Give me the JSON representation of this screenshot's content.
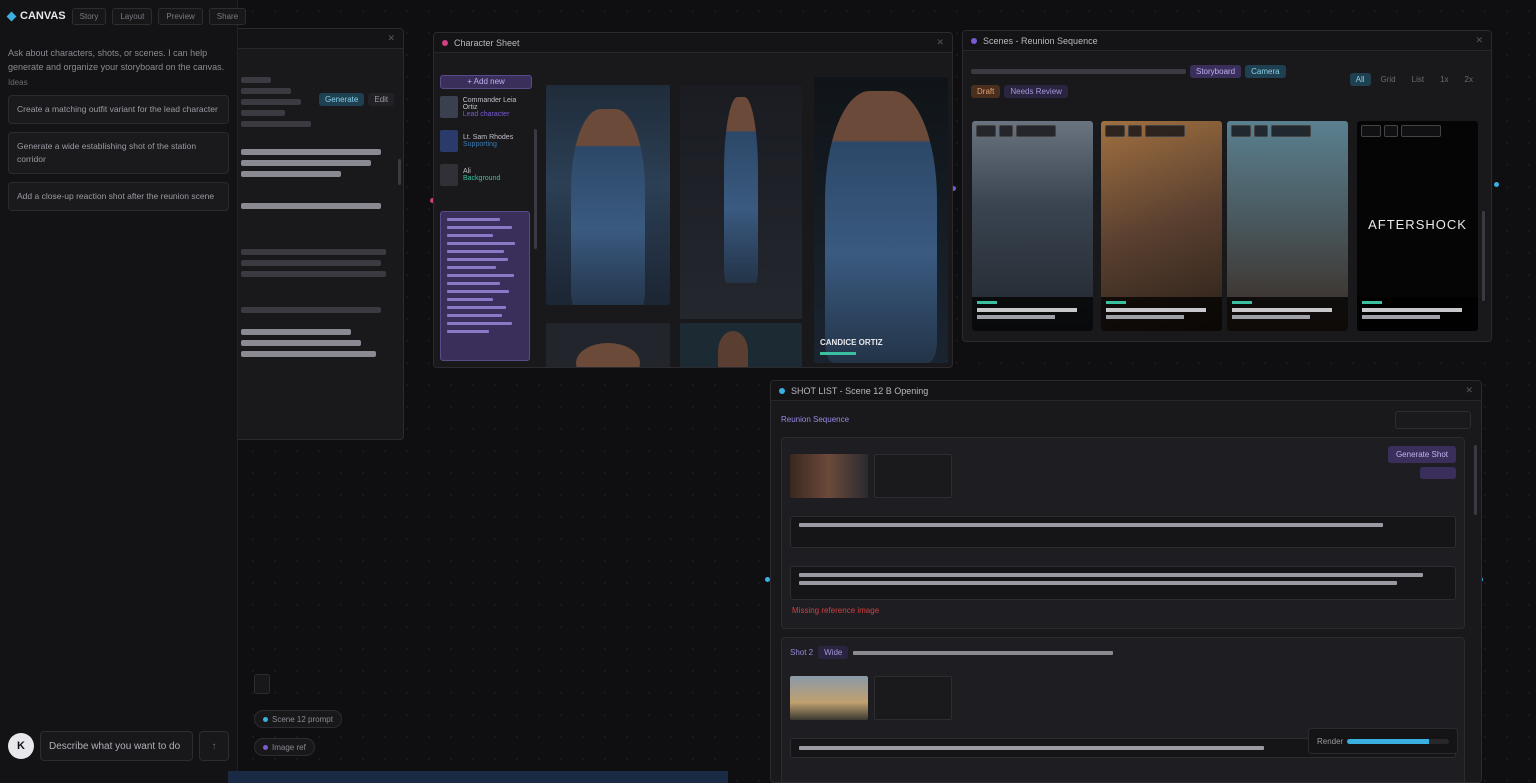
{
  "app": {
    "name": "CANVAS",
    "top_tabs": [
      "Story",
      "Layout",
      "Preview",
      "Share"
    ]
  },
  "chat": {
    "intro": "Ask about characters, shots, or scenes. I can help generate and organize your storyboard on the canvas.",
    "section_label": "Ideas",
    "suggestions": [
      "Create a matching outfit variant for the lead character",
      "Generate a wide establishing shot of the station corridor",
      "Add a close-up reaction shot after the reunion scene"
    ],
    "composer_placeholder": "Describe what you want to do",
    "user_initial": "K"
  },
  "text_panel": {
    "action_label": "Generate",
    "action_secondary": "Edit"
  },
  "character_panel": {
    "title": "Character Sheet",
    "add_label": "+ Add new",
    "characters": [
      {
        "name": "Commander Leia Ortiz",
        "sub": "Lead character"
      },
      {
        "name": "Lt. Sam Rhodes",
        "sub": "Supporting"
      },
      {
        "name": "Ali",
        "sub": "Background"
      }
    ],
    "caption": "CANDICE ORTIZ"
  },
  "scenes_panel": {
    "title": "Scenes - Reunion Sequence",
    "tags": [
      "Storyboard",
      "Camera"
    ],
    "filters": [
      "Draft",
      "Needs Review"
    ],
    "view_options": [
      "All",
      "Grid",
      "List",
      "1x",
      "2x"
    ],
    "scene_overlay_text": "AFTERSHOCK"
  },
  "shot_panel": {
    "title": "SHOT LIST - Scene 12 B Opening",
    "subtitle": "Reunion Sequence",
    "primary_action": "Generate Shot",
    "card2_badge": "Wide",
    "card2_title": "Shot 2",
    "error_text": "Missing reference image"
  },
  "nodes": {
    "node1": "Scene 12 prompt",
    "node2": "Image ref"
  },
  "status": {
    "label": "Render",
    "progress": 0.8
  },
  "colors": {
    "accent_blue": "#3ab0e0",
    "accent_purple": "#7a5ad0",
    "accent_teal": "#3ac0a0",
    "error": "#d04040"
  }
}
